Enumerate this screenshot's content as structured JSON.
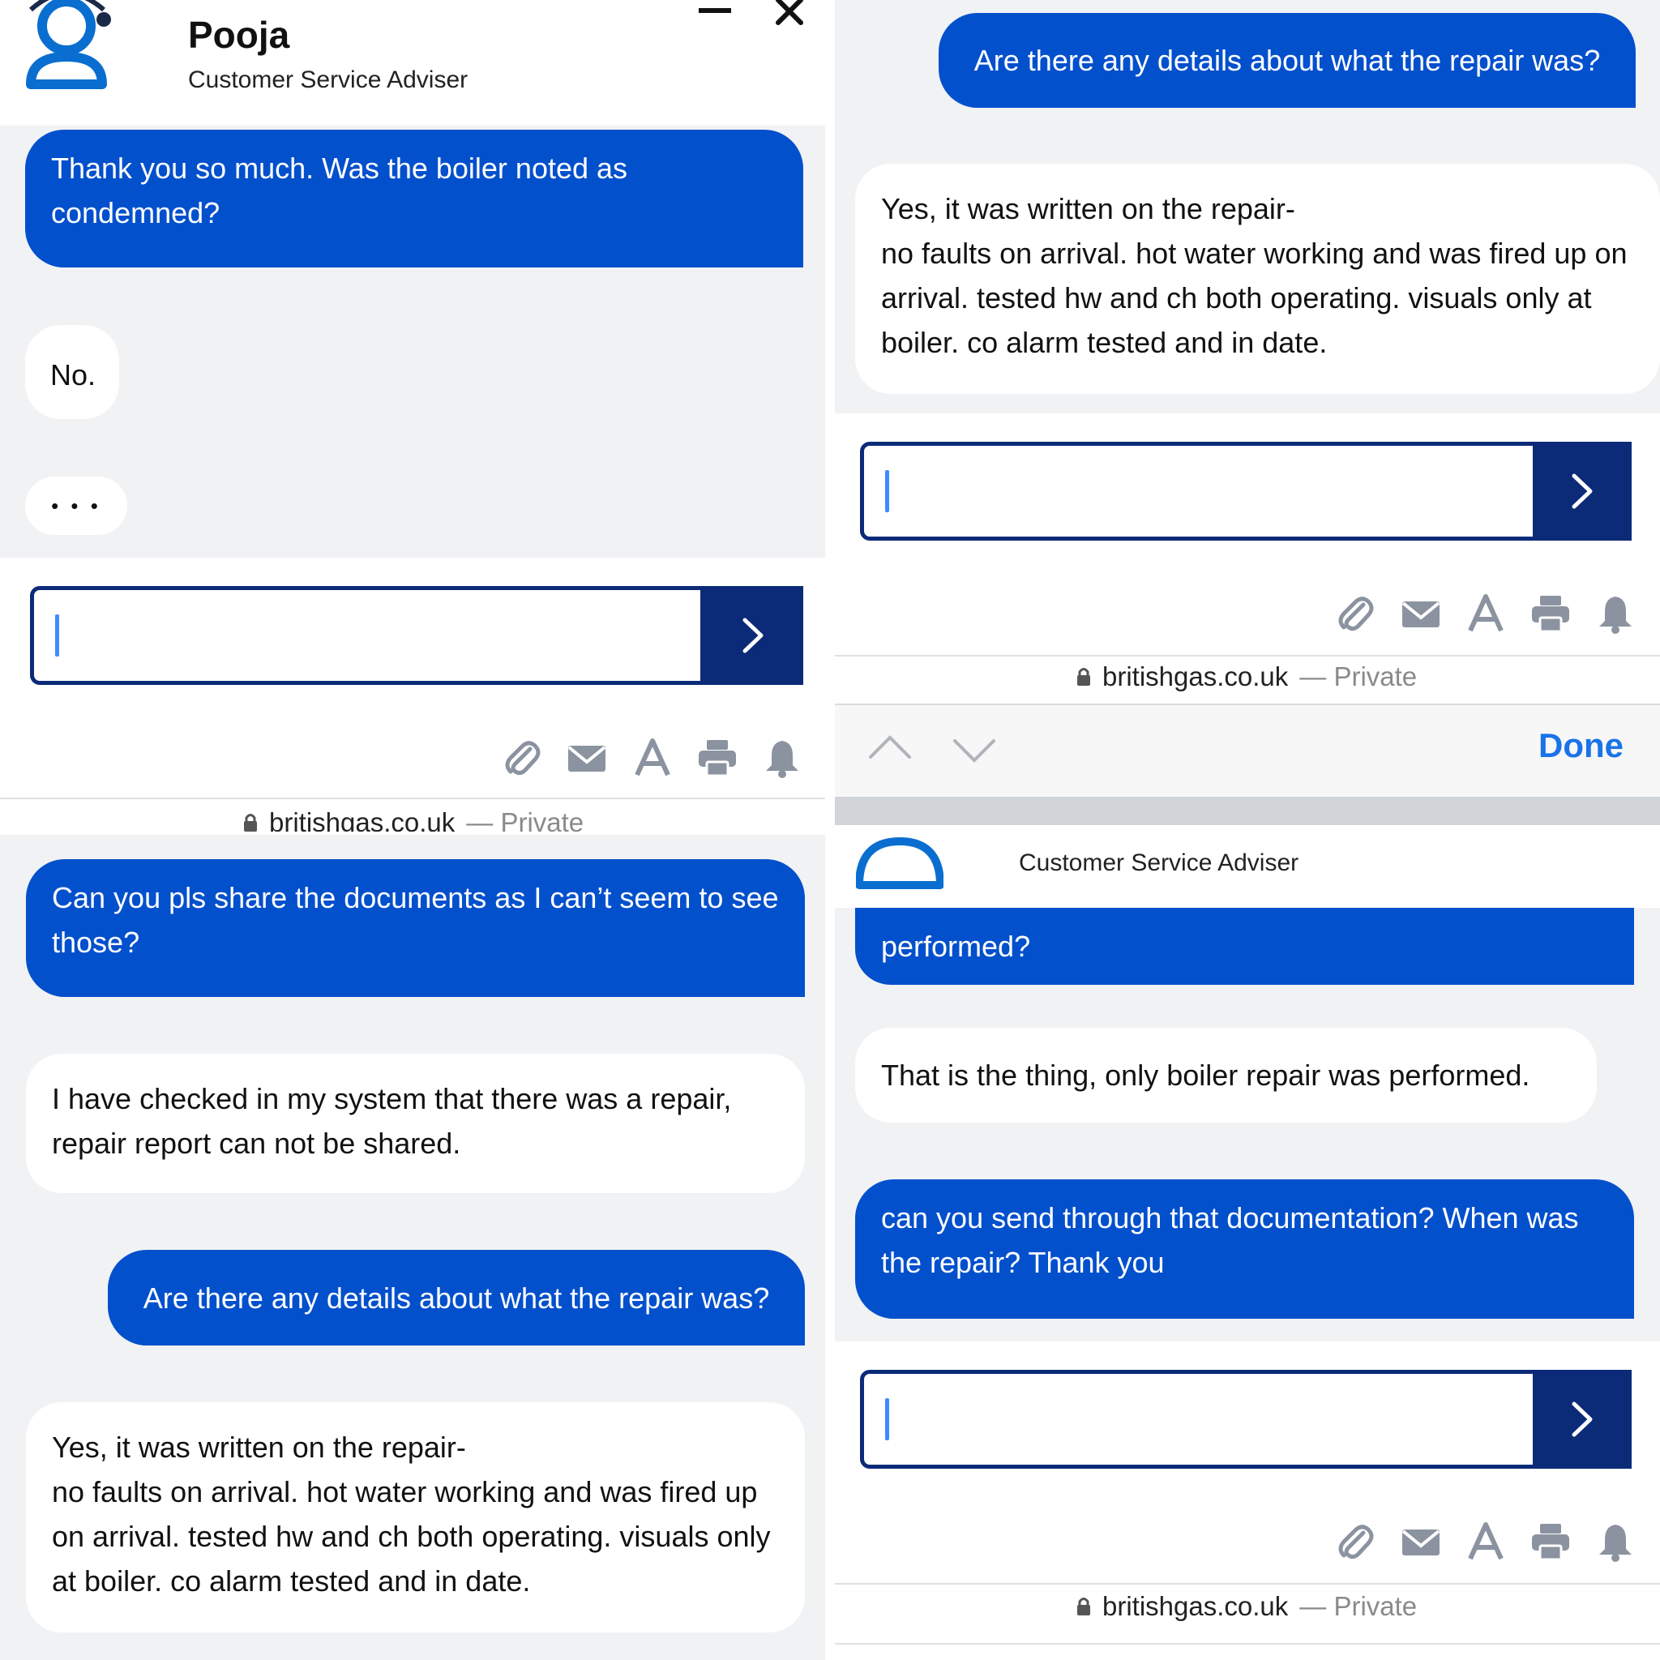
{
  "agent": {
    "name": "Pooja",
    "role": "Customer Service Adviser"
  },
  "messages": {
    "condemned_q": "Thank you so much. Was the boiler noted as condemned?",
    "no": "No.",
    "typing": "• • •",
    "share_docs": "Can you pls share the documents as I can’t seem to see those?",
    "checked": "I have checked in my system that there was a repair, repair report can not be shared.",
    "details_q": "Are there any details about what the repair was?",
    "written_1": "Yes, it was written on the repair-",
    "written_2": "no faults on arrival. hot water working and was fired up on arrival. tested hw and ch both operating. visuals only at boiler. co alarm tested and in date.",
    "performed_tail": "performed?",
    "only_boiler": "That is the thing, only boiler repair was performed.",
    "send_through": "can you send through that documentation? When was the repair? Thank you"
  },
  "browser": {
    "domain": "britishgas.co.uk",
    "private": "— Private",
    "done": "Done"
  },
  "icons": [
    "attach-icon",
    "mail-icon",
    "font-size-icon",
    "print-icon",
    "bell-icon",
    "lock-icon",
    "send-arrow-icon",
    "minimize-icon",
    "close-icon",
    "avatar-icon",
    "chevron-up-icon",
    "chevron-down-icon"
  ],
  "colors": {
    "user_bubble": "#0350cd",
    "send_button": "#0b2a78",
    "done_link": "#1a73e8"
  }
}
